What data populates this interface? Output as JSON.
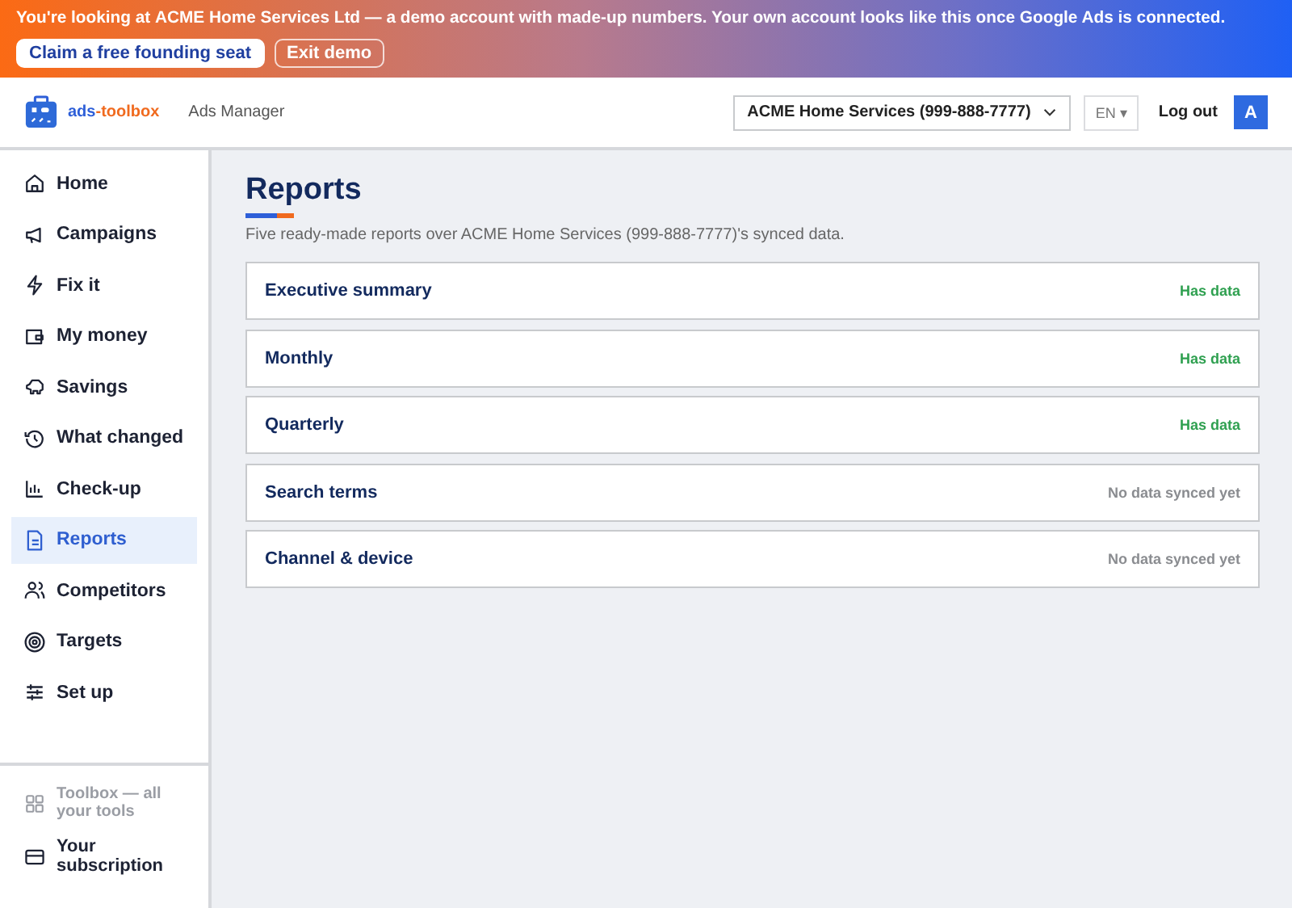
{
  "banner": {
    "message": "You're looking at **ACME Home Services Ltd** — a demo account with made-up numbers. Your own account looks like this once Google Ads is connected.",
    "buttons": [
      {
        "label": "Claim a free founding seat",
        "kind": "primary"
      },
      {
        "label": "Exit demo",
        "kind": "outline"
      }
    ]
  },
  "header": {
    "logo": {
      "part_1": "ads",
      "part_2": "-toolbox"
    },
    "product": "Ads Manager",
    "account_select": "ACME Home Services (999-888-7777)",
    "language": "EN ▾",
    "logout": "Log out",
    "avatar": "A"
  },
  "sidebar": {
    "items": [
      {
        "label": "Home",
        "selected": false
      },
      {
        "label": "Campaigns",
        "selected": false
      },
      {
        "label": "Fix it",
        "selected": false
      },
      {
        "label": "My money",
        "selected": false
      },
      {
        "label": "Savings",
        "selected": false
      },
      {
        "label": "What changed",
        "selected": false
      },
      {
        "label": "Check-up",
        "selected": false
      },
      {
        "label": "Reports",
        "selected": true
      },
      {
        "label": "Competitors",
        "selected": false
      },
      {
        "label": "Targets",
        "selected": false
      },
      {
        "label": "Set up",
        "selected": false
      }
    ],
    "footer_items": [
      {
        "label": "Toolbox — all your tools",
        "disabled": true
      },
      {
        "label": "Your subscription",
        "disabled": false
      }
    ]
  },
  "page": {
    "title": "Reports",
    "subtitle": "Five ready-made reports over ACME Home Services (999-888-7777)'s synced data.",
    "reports": [
      {
        "name": "Executive summary",
        "status": "Has data",
        "has_data": true
      },
      {
        "name": "Monthly",
        "status": "Has data",
        "has_data": true
      },
      {
        "name": "Quarterly",
        "status": "Has data",
        "has_data": true
      },
      {
        "name": "Search terms",
        "status": "No data synced yet",
        "has_data": false
      },
      {
        "name": "Channel & device",
        "status": "No data synced yet",
        "has_data": false
      }
    ]
  }
}
